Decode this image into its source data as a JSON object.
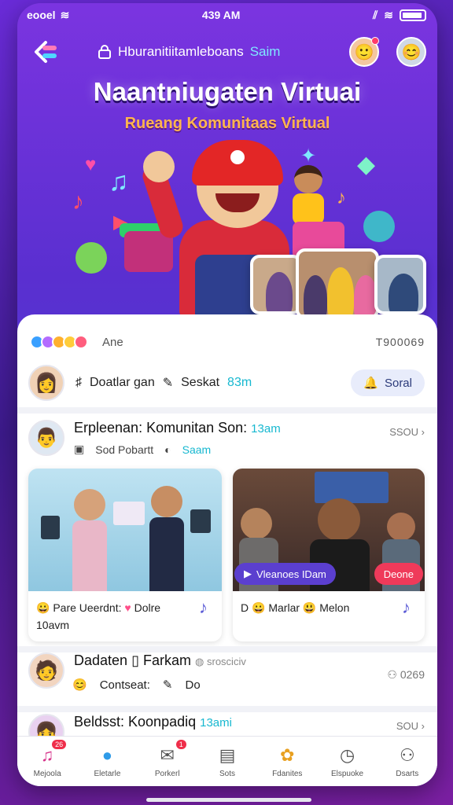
{
  "status_bar": {
    "carrier": "eooel",
    "time": "439 AM"
  },
  "header": {
    "title": "Hburanitiitamleboans",
    "title_accent": "Saim",
    "hero_title": "Naantniugaten Virtuai",
    "hero_subtitle": "Rueang Komunitaas Virtual"
  },
  "reactions": {
    "label": "Ane",
    "count": "T900069"
  },
  "composer": {
    "text": "Doatlar gan",
    "action": "Seskat",
    "time": "83m",
    "social_button": "Soral"
  },
  "post1": {
    "title": "Erpleenan: Komunitan Son:",
    "time": "13am",
    "meta1": "Sod Pobartt",
    "meta2": "Saam",
    "more": "SSOU"
  },
  "media1": {
    "caption_a": "Pare Ueerdnt:",
    "caption_b": "Dolre",
    "caption_line2": "10avm"
  },
  "media2": {
    "pill_left": "Vleanoes IDam",
    "pill_right": "Deone",
    "caption_a": "D",
    "caption_b": "Marlar",
    "caption_c": "Melon"
  },
  "post2": {
    "title": "Dadaten",
    "title_b": "Farkam",
    "handle": "srosciciv",
    "count": "0269",
    "sub_a": "Contseat:",
    "sub_b": "Do"
  },
  "post3": {
    "title": "Beldsst: Koonpadiq",
    "time": "13ami",
    "more": "SOU"
  },
  "nav": {
    "items": [
      {
        "label": "Mejoola",
        "badge": "26",
        "icon": "music-note-icon"
      },
      {
        "label": "Eletarle",
        "badge": "",
        "icon": "chat-bubble-icon"
      },
      {
        "label": "Porkerl",
        "badge": "1",
        "icon": "mail-icon"
      },
      {
        "label": "Sots",
        "badge": "",
        "icon": "newspaper-icon"
      },
      {
        "label": "Fdanites",
        "badge": "",
        "icon": "gift-icon"
      },
      {
        "label": "Elspuoke",
        "badge": "",
        "icon": "clock-icon"
      },
      {
        "label": "Dsarts",
        "badge": "",
        "icon": "profile-icon"
      }
    ]
  },
  "colors": {
    "accent": "#7fe8ff",
    "brand_purple": "#6a2bd8",
    "cyan_text": "#17b8d0",
    "badge_red": "#ef2e4a"
  }
}
